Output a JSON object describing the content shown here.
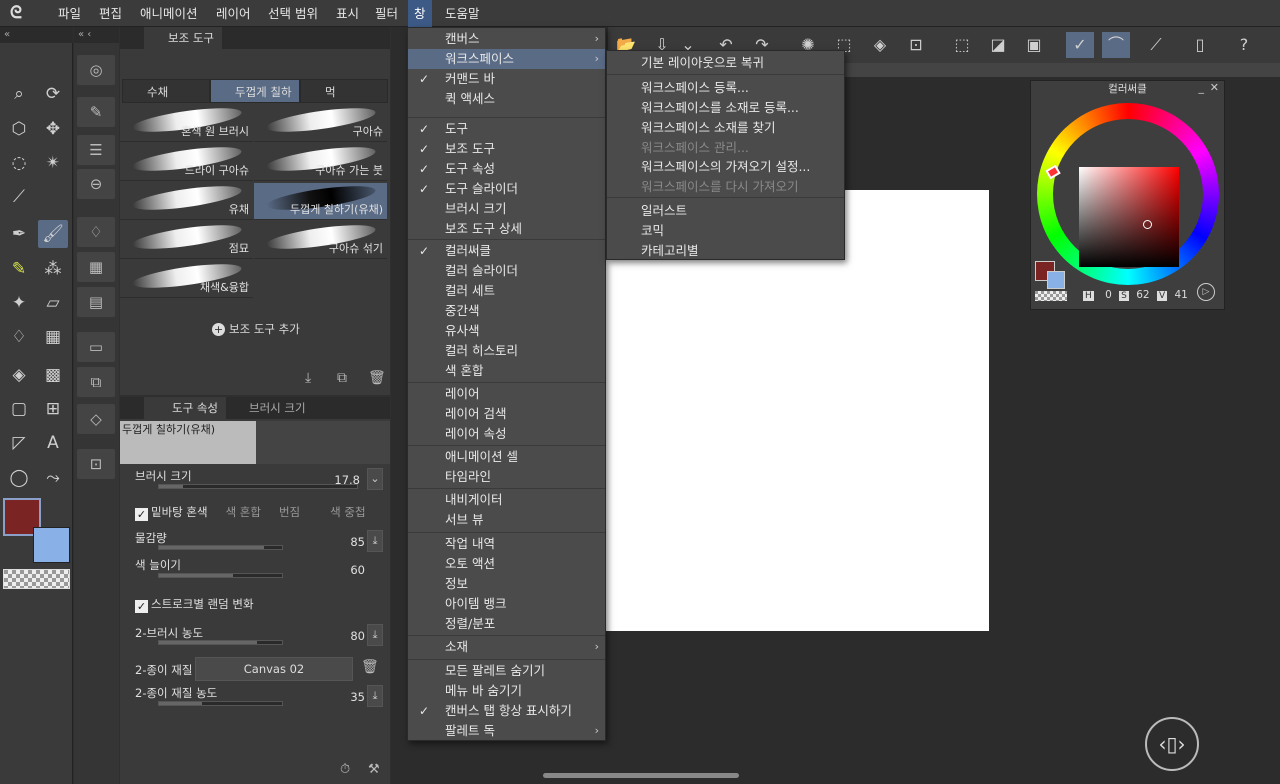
{
  "menubar": {
    "items": [
      "파일",
      "편집",
      "애니메이션",
      "레이어",
      "선택 범위",
      "표시",
      "필터",
      "창",
      "도움말"
    ]
  },
  "subtool_panel": {
    "header_tab": "보조 도구",
    "tabs": [
      "수채",
      "두껍게 칠하기",
      "먹"
    ],
    "brushes": [
      {
        "label": "혼색 원 브러시"
      },
      {
        "label": "구아슈"
      },
      {
        "label": "드라이 구아슈"
      },
      {
        "label": "구아슈 가는 붓"
      },
      {
        "label": "유채"
      },
      {
        "label": "두껍게 칠하기(유채)"
      },
      {
        "label": "점묘"
      },
      {
        "label": "구아슈 섞기"
      },
      {
        "label": "채색&융합"
      }
    ],
    "add_label": "보조 도구 추가"
  },
  "tool_property": {
    "tabs": [
      "도구 속성",
      "브러시 크기"
    ],
    "preview_name": "두껍게 칠하기(유채)",
    "brush_size_label": "브러시 크기",
    "brush_size_value": "17.8",
    "mix_label": "밑바탕 혼색",
    "mix_opts": [
      "색 혼합",
      "번짐",
      "색 중첩"
    ],
    "paint_amount_label": "물감량",
    "paint_amount_value": "85",
    "color_stretch_label": "색 늘이기",
    "color_stretch_value": "60",
    "random_label": "스트로크별 랜덤 변화",
    "brush2_density_label": "2-브러시 농도",
    "brush2_density_value": "80",
    "paper_label": "2-종이 재질",
    "paper_value": "Canvas 02",
    "paper_density_label": "2-종이 재질 농도",
    "paper_density_value": "35"
  },
  "color_wheel": {
    "title": "컬러써클",
    "h_label": "H",
    "h_value": "0",
    "s_label": "S",
    "s_value": "62",
    "v_label": "V",
    "v_value": "41",
    "main_color": "#7a2424",
    "sub_color": "#8ab0e8"
  },
  "window_menu": {
    "items": [
      {
        "label": "캔버스",
        "check": false,
        "arrow": true
      },
      {
        "label": "워크스페이스",
        "check": false,
        "arrow": true,
        "highlight": true
      },
      {
        "label": "커맨드 바",
        "check": true
      },
      {
        "label": "퀵 액세스",
        "check": false
      },
      {
        "label": "도구",
        "check": true
      },
      {
        "label": "보조 도구",
        "check": true
      },
      {
        "label": "도구 속성",
        "check": true
      },
      {
        "label": "도구 슬라이더",
        "check": true
      },
      {
        "label": "브러시 크기",
        "check": false
      },
      {
        "label": "보조 도구 상세",
        "check": false
      },
      {
        "label": "컬러써클",
        "check": true
      },
      {
        "label": "컬러 슬라이더",
        "check": false
      },
      {
        "label": "컬러 세트",
        "check": false
      },
      {
        "label": "중간색",
        "check": false
      },
      {
        "label": "유사색",
        "check": false
      },
      {
        "label": "컬러 히스토리",
        "check": false
      },
      {
        "label": "색 혼합",
        "check": false
      },
      {
        "label": "레이어",
        "check": false
      },
      {
        "label": "레이어 검색",
        "check": false
      },
      {
        "label": "레이어 속성",
        "check": false
      },
      {
        "label": "애니메이션 셀",
        "check": false
      },
      {
        "label": "타임라인",
        "check": false
      },
      {
        "label": "내비게이터",
        "check": false
      },
      {
        "label": "서브 뷰",
        "check": false
      },
      {
        "label": "작업 내역",
        "check": false
      },
      {
        "label": "오토 액션",
        "check": false
      },
      {
        "label": "정보",
        "check": false
      },
      {
        "label": "아이템 뱅크",
        "check": false
      },
      {
        "label": "정렬/분포",
        "check": false
      },
      {
        "label": "소재",
        "check": false,
        "arrow": true
      },
      {
        "label": "모든 팔레트 숨기기",
        "check": false
      },
      {
        "label": "메뉴 바 숨기기",
        "check": false
      },
      {
        "label": "캔버스 탭 항상 표시하기",
        "check": true
      },
      {
        "label": "팔레트 독",
        "check": false,
        "arrow": true
      }
    ],
    "check_glyph": "✓",
    "arrow_glyph": "›"
  },
  "workspace_submenu": {
    "items": [
      {
        "label": "기본 레이아웃으로 복귀",
        "disabled": false
      },
      {
        "label": "워크스페이스 등록...",
        "disabled": false
      },
      {
        "label": "워크스페이스를 소재로 등록...",
        "disabled": false
      },
      {
        "label": "워크스페이스 소재를 찾기",
        "disabled": false
      },
      {
        "label": "워크스페이스 관리...",
        "disabled": true
      },
      {
        "label": "워크스페이스의 가져오기 설정...",
        "disabled": false
      },
      {
        "label": "워크스페이스를 다시 가져오기",
        "disabled": true
      },
      {
        "label": "일러스트",
        "disabled": false
      },
      {
        "label": "코믹",
        "disabled": false
      },
      {
        "label": "카테고리별",
        "disabled": false
      }
    ]
  }
}
